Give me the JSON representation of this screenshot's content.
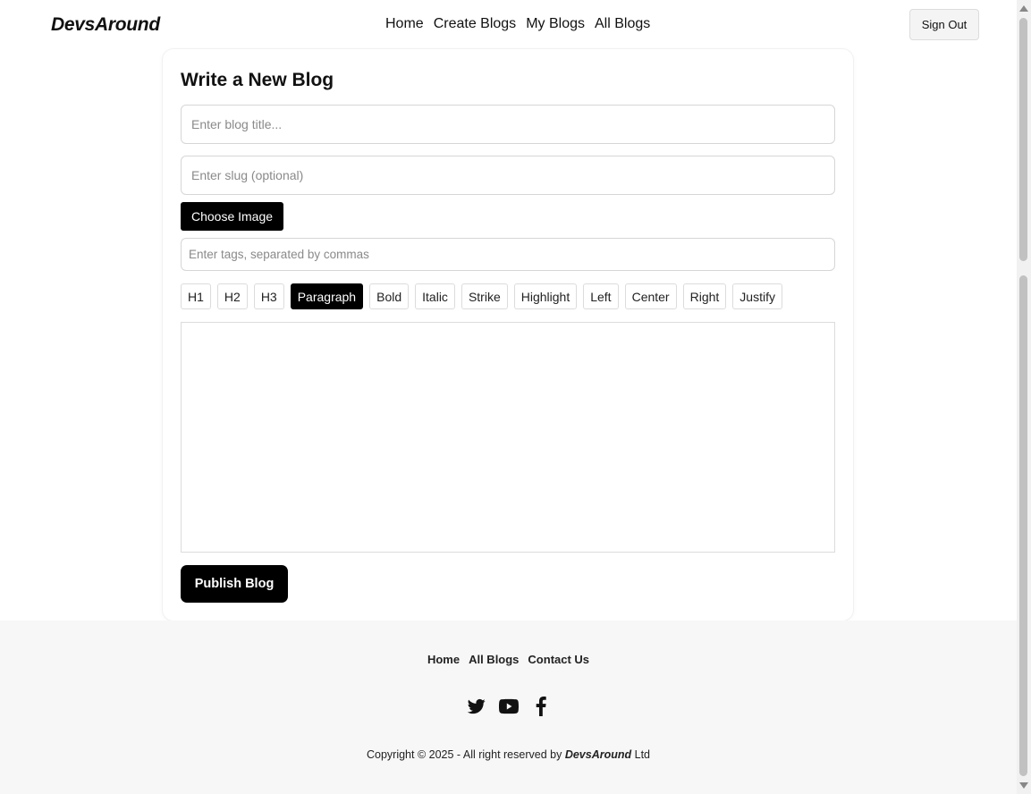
{
  "header": {
    "logo": "DevsAround",
    "nav": [
      "Home",
      "Create Blogs",
      "My Blogs",
      "All Blogs"
    ],
    "sign_out": "Sign Out"
  },
  "form": {
    "title": "Write a New Blog",
    "title_placeholder": "Enter blog title...",
    "slug_placeholder": "Enter slug (optional)",
    "choose_image": "Choose Image",
    "tags_placeholder": "Enter tags, separated by commas",
    "toolbar": [
      "H1",
      "H2",
      "H3",
      "Paragraph",
      "Bold",
      "Italic",
      "Strike",
      "Highlight",
      "Left",
      "Center",
      "Right",
      "Justify"
    ],
    "toolbar_active": "Paragraph",
    "publish": "Publish Blog"
  },
  "footer": {
    "links": [
      "Home",
      "All Blogs",
      "Contact Us"
    ],
    "social_icons": [
      "twitter-icon",
      "youtube-icon",
      "facebook-icon"
    ],
    "copyright_prefix": "Copyright © 2025 - All right reserved by ",
    "copyright_brand": "DevsAround",
    "copyright_suffix": " Ltd"
  },
  "colors": {
    "primary": "#000000",
    "footer_bg": "#f7f7f7"
  }
}
